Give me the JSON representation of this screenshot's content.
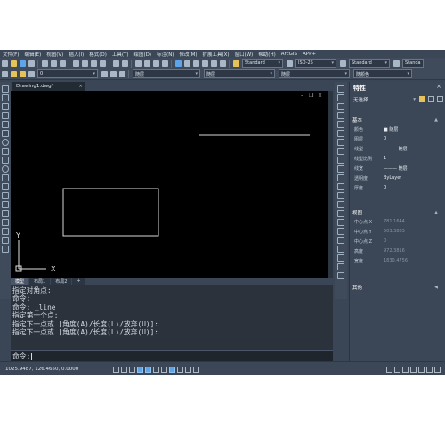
{
  "menu": [
    "文件(F)",
    "编辑(E)",
    "视图(V)",
    "插入(I)",
    "格式(O)",
    "工具(T)",
    "绘图(D)",
    "标注(N)",
    "修改(M)",
    "扩展工具(X)",
    "窗口(W)",
    "帮助(H)",
    "ArcGIS",
    "APP+"
  ],
  "toolbar": {
    "text_style": "Standard",
    "dim_style": "ISO-25",
    "table_style": "Standard",
    "multileader_style": "Standa",
    "layer": "0",
    "color": "随层",
    "linetype": "随层",
    "lineweight": "随层",
    "plotstyle": "随颜色"
  },
  "drawing_tab": {
    "title": "Drawing1.dwg*",
    "close": "×"
  },
  "viewport": {
    "win_min": "–",
    "win_restore": "❐",
    "win_close": "×",
    "axis_x": "X",
    "axis_y": "Y"
  },
  "layout_tabs": [
    "模型",
    "布局1",
    "布局2",
    "+"
  ],
  "command_history": [
    "指定对角点:",
    "命令:",
    "命令: _line",
    "指定第一个点:",
    "指定下一点或 [角度(A)/长度(L)/放弃(U)]:",
    "指定下一点或 [角度(A)/长度(L)/放弃(U)]:"
  ],
  "command_prompt": "命令:",
  "status": {
    "coordinates": "1025.9487, 126.4650, 0.0000"
  },
  "properties": {
    "title": "特性",
    "close": "×",
    "selection": "无选择",
    "sections": {
      "basic": "基本",
      "view": "视图",
      "misc": "其他"
    },
    "basic_rows": [
      {
        "name": "颜色",
        "value": "■ 随层"
      },
      {
        "name": "图层",
        "value": "0"
      },
      {
        "name": "线型",
        "value": "——— 随层"
      },
      {
        "name": "线型比例",
        "value": "1"
      },
      {
        "name": "线宽",
        "value": "——— 随层"
      },
      {
        "name": "透明度",
        "value": "ByLayer"
      },
      {
        "name": "厚度",
        "value": "0"
      }
    ],
    "view_rows": [
      {
        "name": "中心点 X",
        "value": "781.1644"
      },
      {
        "name": "中心点 Y",
        "value": "503.3883"
      },
      {
        "name": "中心点 Z",
        "value": "0"
      },
      {
        "name": "高度",
        "value": "972.3816"
      },
      {
        "name": "宽度",
        "value": "1830.4756"
      }
    ]
  },
  "colors": {
    "canvas": "#000000",
    "panel": "#3b4756",
    "command_bg": "#2b323c",
    "accent": "#5ea4e8"
  }
}
